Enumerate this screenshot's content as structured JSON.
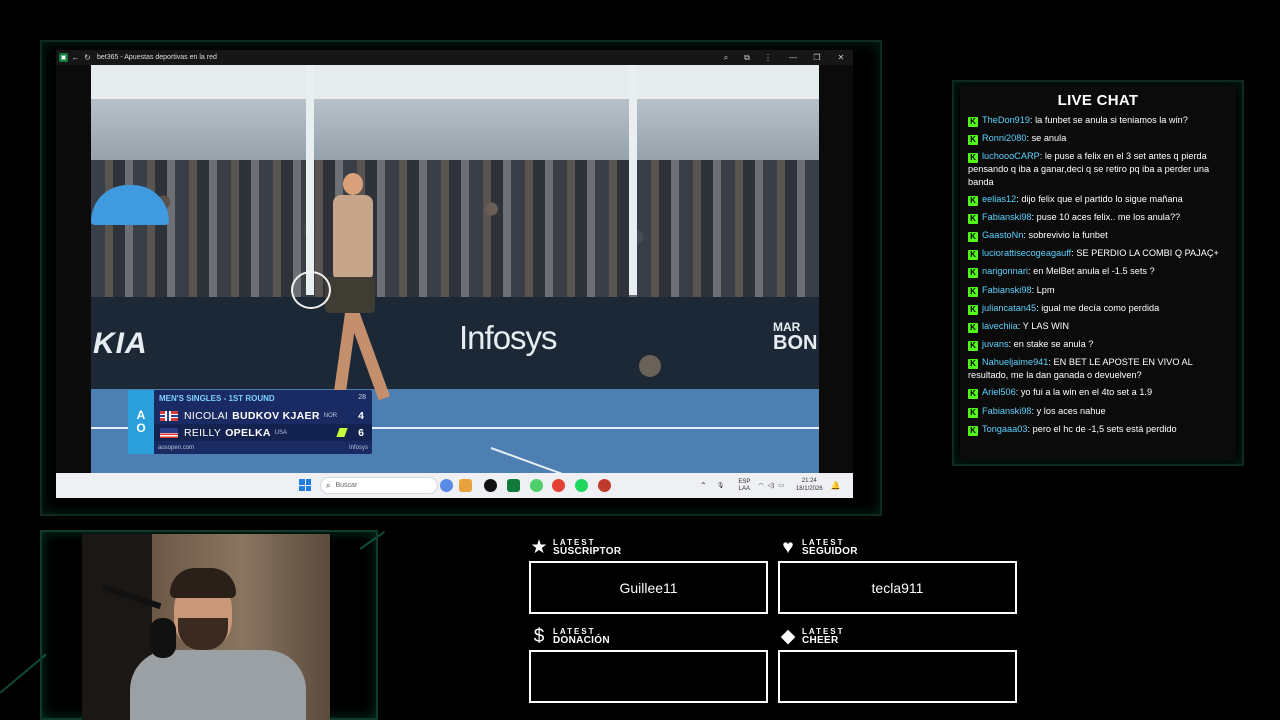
{
  "browser": {
    "tab_title": "bet365 - Apuestas deportivas en la red",
    "site_icon": "site-favicon-icon"
  },
  "video": {
    "ads": {
      "kia": "KIA",
      "infosys": "Infosys",
      "marbon_top": "MAR",
      "marbon_bottom": "BON"
    },
    "scorebug": {
      "round": "MEN'S SINGLES - 1ST ROUND",
      "time": "28",
      "logo_top": "A",
      "logo_bottom": "O",
      "footer_left": "ausopen.com",
      "footer_right": "Infosys",
      "players": [
        {
          "first": "NICOLAI",
          "last": "BUDKOV KJAER",
          "country": "NOR",
          "score": "4"
        },
        {
          "first": "REILLY",
          "last": "OPELKA",
          "country": "USA",
          "score": "6"
        }
      ]
    }
  },
  "taskbar": {
    "search_placeholder": "Buscar",
    "lang_top": "ESP",
    "lang_bottom": "LAA",
    "time": "21:24",
    "date": "18/1/2026"
  },
  "chat": {
    "title": "LIVE CHAT",
    "messages": [
      {
        "user": "TheDon919",
        "text": "la funbet se anula si teniamos la win?"
      },
      {
        "user": "Ronni2080",
        "text": "se anula"
      },
      {
        "user": "luchoooCARP",
        "text": "le puse a felix en el 3 set antes q pierda pensando q iba a ganar,deci q se retiro pq iba a perder una banda"
      },
      {
        "user": "eelias12",
        "text": "dijo felix que el partido lo sigue mañana"
      },
      {
        "user": "Fabianski98",
        "text": "puse 10 aces felix.. me los anula??"
      },
      {
        "user": "GaastoNn",
        "text": "sobrevivio la funbet"
      },
      {
        "user": "luciorattisecogeagauff",
        "text": "SE PERDIO LA COMBI Q PAJAÇ+"
      },
      {
        "user": "narigonnari",
        "text": "en MelBet anula el -1.5 sets ?"
      },
      {
        "user": "Fabianski98",
        "text": "Lpm"
      },
      {
        "user": "juliancatan45",
        "text": "igual me decía como perdida"
      },
      {
        "user": "lavechiia",
        "text": "Y LAS WIN"
      },
      {
        "user": "juvans",
        "text": "en stake se anula ?"
      },
      {
        "user": "Nahueljaime941",
        "text": "EN BET LE APOSTE EN VIVO AL resultado, me la dan ganada o devuelven?"
      },
      {
        "user": "Ariel506",
        "text": "yo fui a la win en el 4to set a 1.9"
      },
      {
        "user": "Fabianski98",
        "text": "y los aces nahue"
      },
      {
        "user": "Tongaaa03",
        "text": "pero el hc de -1,5 sets está perdido"
      }
    ]
  },
  "widgets": {
    "suscriptor": {
      "small": "LATEST",
      "big": "SUSCRIPTOR",
      "value": "Guillee11",
      "icon": "star-icon"
    },
    "seguidor": {
      "small": "LATEST",
      "big": "SEGUIDOR",
      "value": "tecla911",
      "icon": "heart-icon"
    },
    "donacion": {
      "small": "LATEST",
      "big": "DONACIÓN",
      "value": "",
      "icon": "dollar-icon"
    },
    "cheer": {
      "small": "LATEST",
      "big": "CHEER",
      "value": "",
      "icon": "diamond-icon"
    }
  },
  "colors": {
    "accent_frame": "#0f2a22",
    "chat_username": "#5fd2ff",
    "kick_badge": "#53fc18"
  }
}
